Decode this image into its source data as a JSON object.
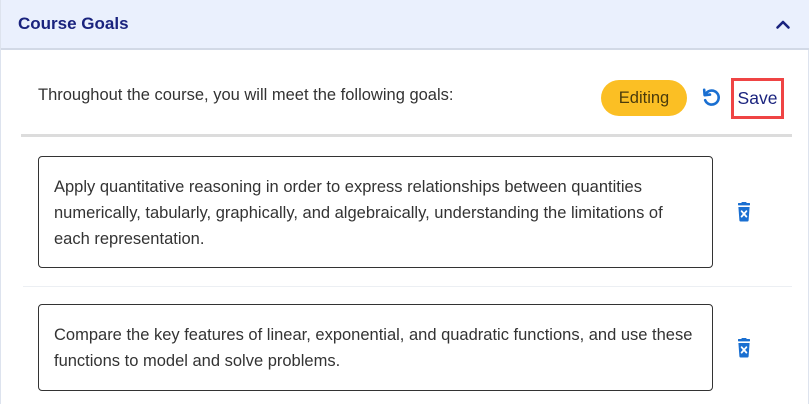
{
  "header": {
    "title": "Course Goals",
    "collapse_icon": "chevron-up-icon"
  },
  "intro": {
    "text": "Throughout the course, you will meet the following goals:"
  },
  "toolbar": {
    "status_badge": "Editing",
    "undo_icon": "undo-icon",
    "save_label": "Save"
  },
  "goals": [
    {
      "text": "Apply quantitative reasoning in order to express relationships between quantities numerically, tabularly, graphically, and algebraically, understanding the limitations of each representation.",
      "delete_icon": "trash-icon"
    },
    {
      "text": "Compare the key features of linear, exponential, and quadratic functions, and use these functions to model and solve problems.",
      "delete_icon": "trash-icon"
    }
  ],
  "colors": {
    "header_bg": "#eaf0fd",
    "title": "#1a237e",
    "badge": "#fbbf24",
    "icon_blue": "#1a6fd1",
    "highlight_border": "#ef4444"
  }
}
